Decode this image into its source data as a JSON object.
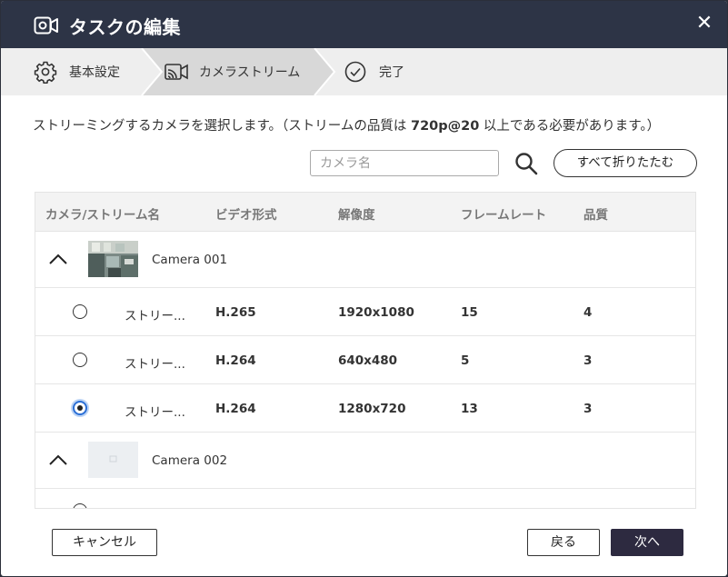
{
  "dialog": {
    "title": "タスクの編集",
    "close_glyph": "✕"
  },
  "stepper": {
    "steps": [
      {
        "label": "基本設定",
        "icon": "gear-icon"
      },
      {
        "label": "カメラストリーム",
        "icon": "cast-camera-icon"
      },
      {
        "label": "完了",
        "icon": "check-circle-icon"
      }
    ],
    "active_step": 2
  },
  "instruction": {
    "prefix": "ストリーミングするカメラを選択します。（ストリームの品質は ",
    "highlight": "720p@20",
    "suffix": " 以上である必要があります。）"
  },
  "search": {
    "placeholder": "カメラ名",
    "value": ""
  },
  "collapse_all_label": "すべて折りたたむ",
  "table": {
    "columns": [
      "カメラ/ストリーム名",
      "ビデオ形式",
      "解像度",
      "フレームレート",
      "品質"
    ],
    "groups": [
      {
        "camera": "Camera 001",
        "expanded": true,
        "streams": [
          {
            "name": "ストリー...",
            "format": "H.265",
            "resolution": "1920x1080",
            "fps": "15",
            "quality": "4",
            "selected": false
          },
          {
            "name": "ストリー...",
            "format": "H.264",
            "resolution": "640x480",
            "fps": "5",
            "quality": "3",
            "selected": false
          },
          {
            "name": "ストリー...",
            "format": "H.264",
            "resolution": "1280x720",
            "fps": "13",
            "quality": "3",
            "selected": true
          }
        ]
      },
      {
        "camera": "Camera 002",
        "expanded": true,
        "streams": []
      }
    ]
  },
  "footer": {
    "cancel_label": "キャンセル",
    "back_label": "戻る",
    "next_label": "次へ"
  },
  "colors": {
    "header_bg": "#2d3446",
    "stepper_bg": "#eeeeee",
    "active_step_bg": "#d8d8d8",
    "primary_button": "#2d2a40",
    "radio_selected": "#2b6fd6"
  }
}
